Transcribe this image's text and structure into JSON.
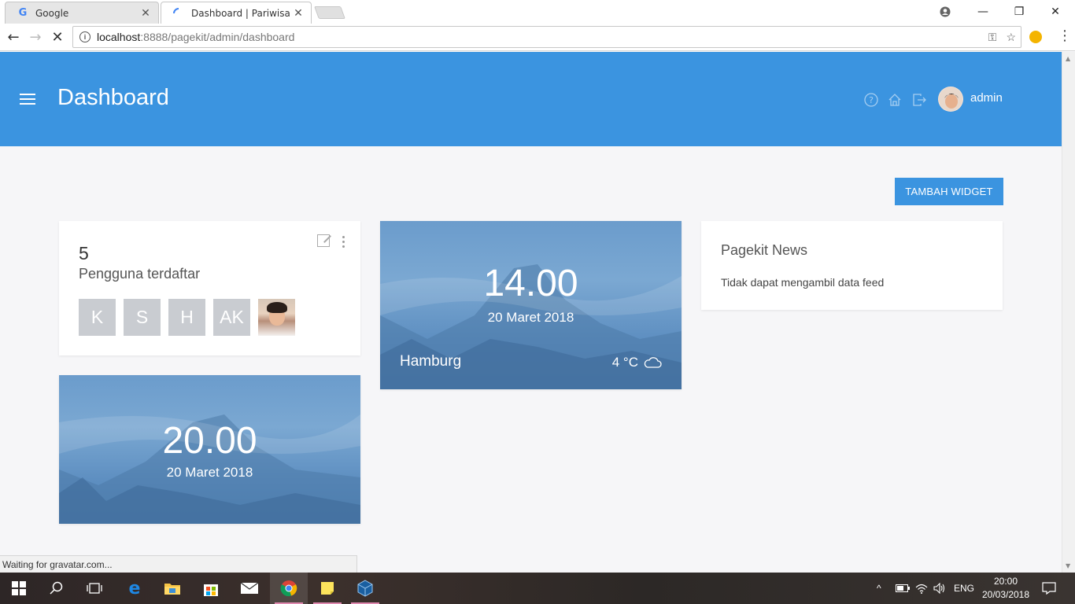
{
  "browser": {
    "tabs": [
      {
        "title": "Google",
        "active": false
      },
      {
        "title": "Dashboard | Pariwisata",
        "active": true
      }
    ],
    "url": {
      "host": "localhost",
      "path": ":8888/pagekit/admin/dashboard"
    },
    "status_text": "Waiting for gravatar.com..."
  },
  "header": {
    "title": "Dashboard",
    "username": "admin",
    "icons": [
      "help-icon",
      "home-icon",
      "logout-icon"
    ]
  },
  "actions": {
    "add_widget": "Tambah Widget"
  },
  "widgets": {
    "users": {
      "count": "5",
      "label": "Pengguna terdaftar",
      "initials": [
        "K",
        "S",
        "H",
        "AK"
      ]
    },
    "clock_hamburg": {
      "time": "14.00",
      "date": "20 Maret 2018",
      "city": "Hamburg",
      "temperature": "4 °C",
      "weather_icon": "cloud-icon"
    },
    "clock_local": {
      "time": "20.00",
      "date": "20 Maret 2018"
    },
    "news": {
      "title": "Pagekit News",
      "message": "Tidak dapat mengambil data feed"
    }
  },
  "taskbar": {
    "language": "ENG",
    "time": "20:00",
    "date": "20/03/2018"
  },
  "colors": {
    "primary": "#3b94e0",
    "background": "#f6f6f8",
    "avatar_tile": "#c9ccd1"
  }
}
